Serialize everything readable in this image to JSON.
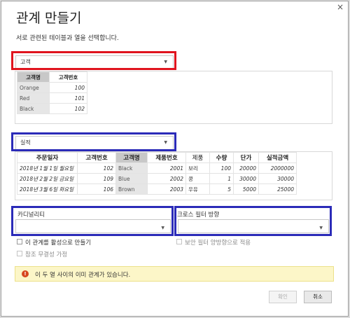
{
  "dialog": {
    "close_glyph": "×",
    "title": "관계 만들기",
    "subtitle": "서로 관련된 테이블과 열을 선택합니다."
  },
  "table1": {
    "selected": "고객",
    "headers": [
      "고객명",
      "고객번호"
    ],
    "rows": [
      [
        "Orange",
        "100"
      ],
      [
        "Red",
        "101"
      ],
      [
        "Black",
        "102"
      ]
    ]
  },
  "table2": {
    "selected": "실적",
    "headers": [
      "주문일자",
      "고객번호",
      "고객명",
      "제품번호",
      "제품",
      "수량",
      "단가",
      "실적금액"
    ],
    "rows": [
      [
        "2018년 1월 1일 월요일",
        "102",
        "Black",
        "2001",
        "보리",
        "100",
        "20000",
        "2000000"
      ],
      [
        "2018년 2월 2일 금요일",
        "109",
        "Blue",
        "2002",
        "콩",
        "1",
        "30000",
        "30000"
      ],
      [
        "2018년 3월 6일 화요일",
        "106",
        "Brown",
        "2003",
        "우유",
        "5",
        "5000",
        "25000"
      ]
    ]
  },
  "cardinality": {
    "label": "카디널리티",
    "value": ""
  },
  "cross_filter": {
    "label": "크로스 필터 방향",
    "value": ""
  },
  "options": {
    "activate": "이 관계를 활성으로 만들기",
    "bidirectional": "보안 필터 양방향으로 적용",
    "referential": "참조 무결성 가정"
  },
  "warning": {
    "icon": "!",
    "text": "이 두 열 사이의 이미 관계가 있습니다."
  },
  "buttons": {
    "ok": "확인",
    "cancel": "취소"
  },
  "colors": {
    "highlight_red": "#e0141e",
    "highlight_blue": "#2b2bb8",
    "warning_bg": "#fcf6c8"
  }
}
